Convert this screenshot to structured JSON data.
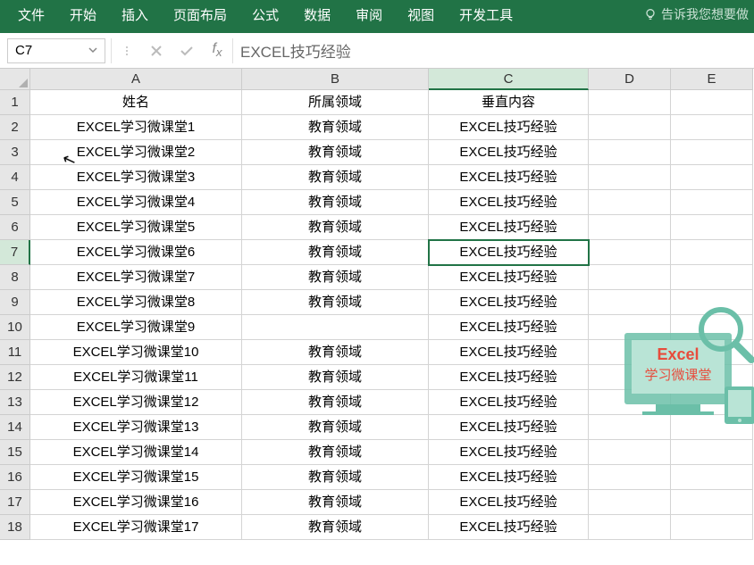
{
  "ribbon": {
    "tabs": [
      "文件",
      "开始",
      "插入",
      "页面布局",
      "公式",
      "数据",
      "审阅",
      "视图",
      "开发工具"
    ],
    "tell_me": "告诉我您想要做"
  },
  "formula_bar": {
    "name_box": "C7",
    "value": "EXCEL技巧经验"
  },
  "columns": [
    "A",
    "B",
    "C",
    "D",
    "E"
  ],
  "selected": {
    "col": "C",
    "row": 7
  },
  "rows": [
    {
      "n": 1,
      "A": "姓名",
      "B": "所属领域",
      "C": "垂直内容"
    },
    {
      "n": 2,
      "A": "EXCEL学习微课堂1",
      "B": "教育领域",
      "C": "EXCEL技巧经验"
    },
    {
      "n": 3,
      "A": "EXCEL学习微课堂2",
      "B": "教育领域",
      "C": "EXCEL技巧经验"
    },
    {
      "n": 4,
      "A": "EXCEL学习微课堂3",
      "B": "教育领域",
      "C": "EXCEL技巧经验"
    },
    {
      "n": 5,
      "A": "EXCEL学习微课堂4",
      "B": "教育领域",
      "C": "EXCEL技巧经验"
    },
    {
      "n": 6,
      "A": "EXCEL学习微课堂5",
      "B": "教育领域",
      "C": "EXCEL技巧经验"
    },
    {
      "n": 7,
      "A": "EXCEL学习微课堂6",
      "B": "教育领域",
      "C": "EXCEL技巧经验"
    },
    {
      "n": 8,
      "A": "EXCEL学习微课堂7",
      "B": "教育领域",
      "C": "EXCEL技巧经验"
    },
    {
      "n": 9,
      "A": "EXCEL学习微课堂8",
      "B": "教育领域",
      "C": "EXCEL技巧经验"
    },
    {
      "n": 10,
      "A": "EXCEL学习微课堂9",
      "B": "",
      "C": "EXCEL技巧经验"
    },
    {
      "n": 11,
      "A": "EXCEL学习微课堂10",
      "B": "教育领域",
      "C": "EXCEL技巧经验"
    },
    {
      "n": 12,
      "A": "EXCEL学习微课堂11",
      "B": "教育领域",
      "C": "EXCEL技巧经验"
    },
    {
      "n": 13,
      "A": "EXCEL学习微课堂12",
      "B": "教育领域",
      "C": "EXCEL技巧经验"
    },
    {
      "n": 14,
      "A": "EXCEL学习微课堂13",
      "B": "教育领域",
      "C": "EXCEL技巧经验"
    },
    {
      "n": 15,
      "A": "EXCEL学习微课堂14",
      "B": "教育领域",
      "C": "EXCEL技巧经验"
    },
    {
      "n": 16,
      "A": "EXCEL学习微课堂15",
      "B": "教育领域",
      "C": "EXCEL技巧经验"
    },
    {
      "n": 17,
      "A": "EXCEL学习微课堂16",
      "B": "教育领域",
      "C": "EXCEL技巧经验"
    },
    {
      "n": 18,
      "A": "EXCEL学习微课堂17",
      "B": "教育领域",
      "C": "EXCEL技巧经验"
    }
  ],
  "watermark": {
    "title": "Excel",
    "subtitle": "学习微课堂"
  }
}
